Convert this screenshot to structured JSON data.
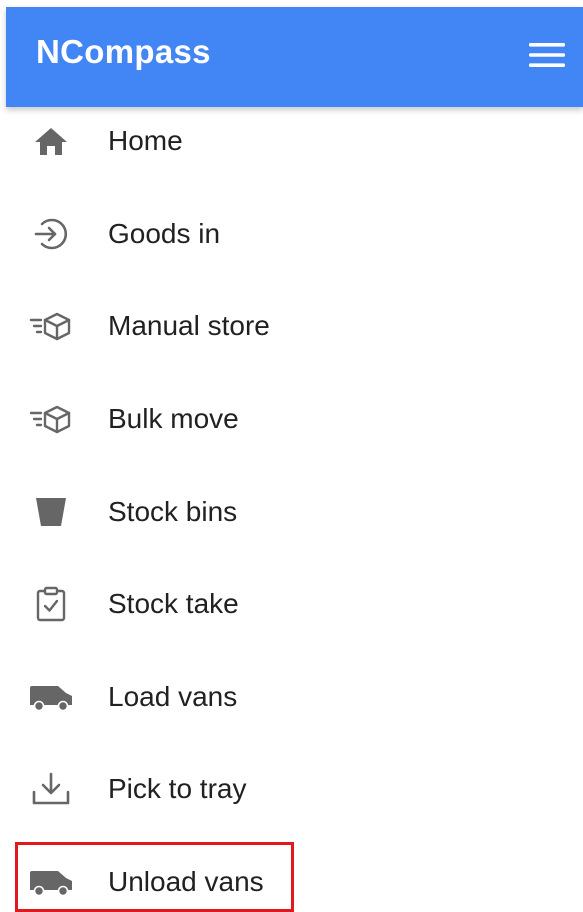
{
  "app": {
    "title": "NCompass",
    "brand_color": "#4285f4",
    "menu_icon": "hamburger-menu-icon"
  },
  "menu": {
    "items": [
      {
        "label": "Home",
        "icon": "home-icon"
      },
      {
        "label": "Goods in",
        "icon": "login-arrow-icon"
      },
      {
        "label": "Manual store",
        "icon": "fast-box-icon"
      },
      {
        "label": "Bulk move",
        "icon": "fast-box-icon"
      },
      {
        "label": "Stock bins",
        "icon": "bin-icon"
      },
      {
        "label": "Stock take",
        "icon": "clipboard-check-icon"
      },
      {
        "label": "Load vans",
        "icon": "van-icon"
      },
      {
        "label": "Pick to tray",
        "icon": "download-tray-icon"
      },
      {
        "label": "Unload vans",
        "icon": "van-icon"
      }
    ]
  },
  "highlight": {
    "target": "Unload vans",
    "color": "#e0191f"
  }
}
